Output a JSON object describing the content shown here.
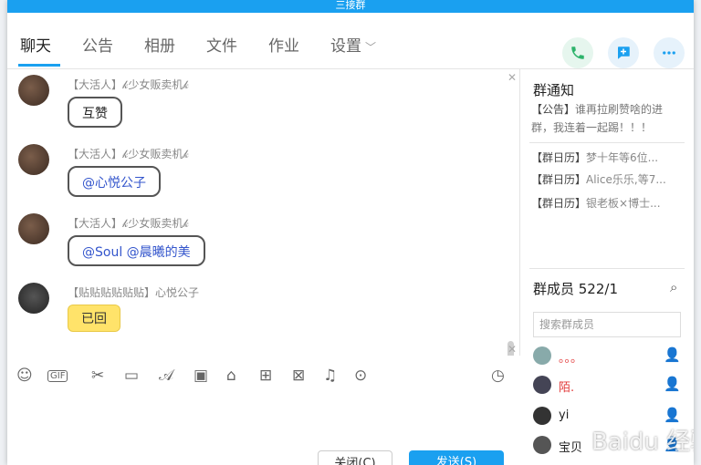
{
  "window": {
    "title": "三接群"
  },
  "tabs": [
    {
      "label": "聊天"
    },
    {
      "label": "公告"
    },
    {
      "label": "相册"
    },
    {
      "label": "文件"
    },
    {
      "label": "作业"
    },
    {
      "label": "设置"
    }
  ],
  "messages": [
    {
      "nick": "【大活人】𝓀少女贩卖机𝓀",
      "text": "互赞"
    },
    {
      "nick": "【大活人】𝓀少女贩卖机𝓀",
      "text": "@心悦公子"
    },
    {
      "nick": "【大活人】𝓀少女贩卖机𝓀",
      "text": "@Soul @晨曦的美"
    },
    {
      "nick": "【贴贴贴贴贴贴】心悦公子",
      "text": "已回"
    }
  ],
  "composer": {
    "close_label": "关闭(C)",
    "send_label": "发送(S)"
  },
  "notice": {
    "title": "群通知",
    "announcement_tag": "【公告】",
    "announcement_text": "谁再拉刷赞啥的进群，我连着一起踢！！！",
    "calendar": [
      {
        "tag": "【群日历】",
        "text": "梦十年等6位..."
      },
      {
        "tag": "【群日历】",
        "text": "Alice乐乐,等7..."
      },
      {
        "tag": "【群日历】",
        "text": "银老板×博士..."
      }
    ]
  },
  "members": {
    "title": "群成员 522/1",
    "search_placeholder": "搜索群成员",
    "list": [
      {
        "name": "。。。"
      },
      {
        "name": "陌."
      },
      {
        "name": "yi"
      },
      {
        "name": "宝贝"
      }
    ]
  },
  "watermark": "Baidu 经验",
  "colors": {
    "accent": "#1aa0f0",
    "mention": "#3355cc",
    "member_name_red": "#e23a3a"
  }
}
